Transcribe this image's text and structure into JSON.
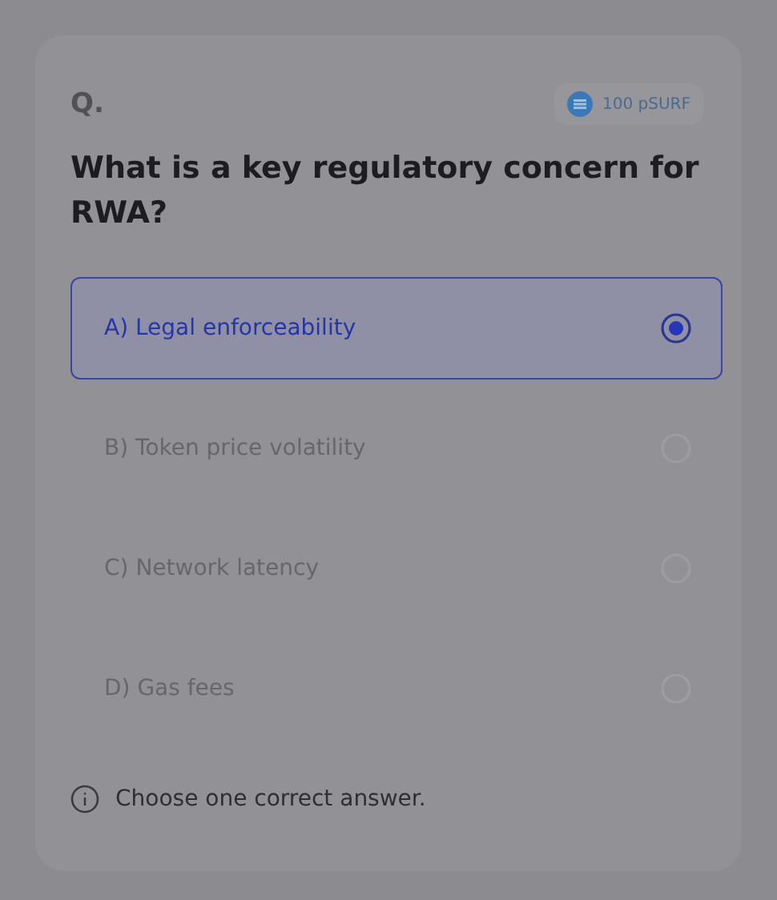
{
  "question": {
    "label": "Q.",
    "reward": "100 pSURF",
    "text": "What is a key regulatory concern for RWA?"
  },
  "options": [
    {
      "label": "A) Legal enforceability",
      "selected": true
    },
    {
      "label": "B) Token price volatility",
      "selected": false
    },
    {
      "label": "C) Network latency",
      "selected": false
    },
    {
      "label": "D) Gas fees",
      "selected": false
    }
  ],
  "hint": "Choose one correct answer."
}
